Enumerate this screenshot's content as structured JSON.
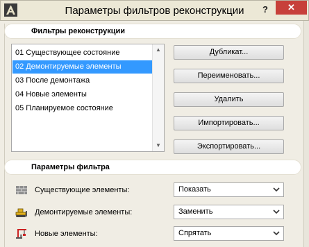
{
  "window": {
    "title": "Параметры фильтров реконструкции",
    "help_label": "?",
    "close_label": "✕"
  },
  "filters_section": {
    "title": "Фильтры реконструкции",
    "items": [
      {
        "label": "01 Существующее состояние",
        "selected": false
      },
      {
        "label": "02 Демонтируемые элементы",
        "selected": true
      },
      {
        "label": "03 После демонтажа",
        "selected": false
      },
      {
        "label": "04 Новые элементы",
        "selected": false
      },
      {
        "label": "05 Планируемое состояние",
        "selected": false
      }
    ]
  },
  "buttons": {
    "duplicate": "Дубликат...",
    "rename": "Переименовать...",
    "delete": "Удалить",
    "import": "Импортировать...",
    "export": "Экспортировать..."
  },
  "params_section": {
    "title": "Параметры фильтра",
    "rows": [
      {
        "label": "Существующие элементы:",
        "value": "Показать",
        "icon": "existing-wall-icon"
      },
      {
        "label": "Демонтируемые элементы:",
        "value": "Заменить",
        "icon": "demolish-bulldozer-icon"
      },
      {
        "label": "Новые элементы:",
        "value": "Спрятать",
        "icon": "new-crane-icon"
      }
    ]
  },
  "colors": {
    "selection": "#3399ff",
    "close_button": "#c7403a"
  }
}
